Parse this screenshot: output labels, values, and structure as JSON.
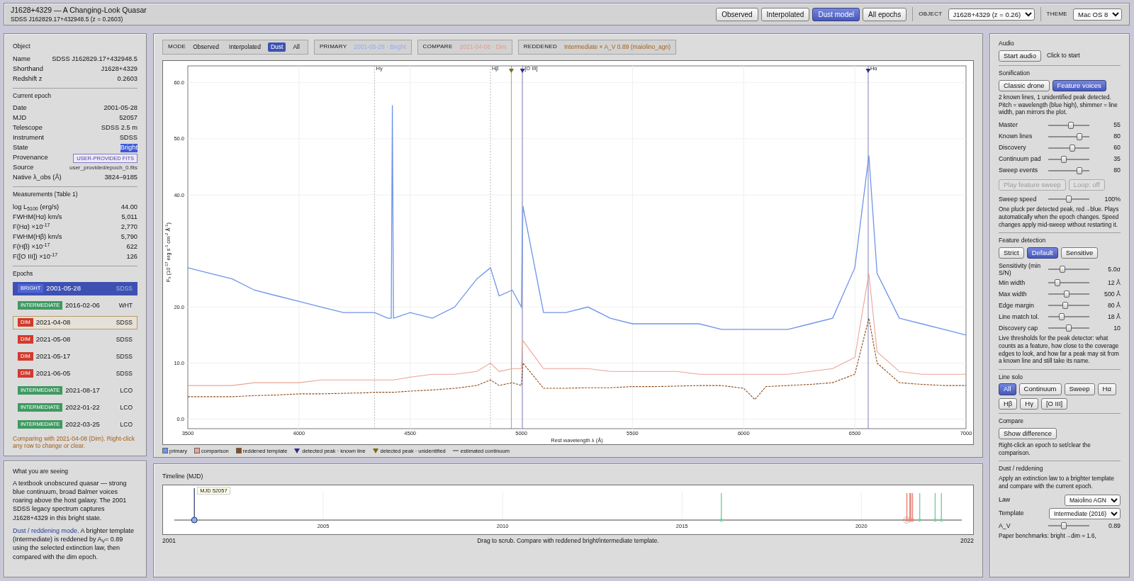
{
  "header": {
    "title": "J1628+4329 — A Changing-Look Quasar",
    "subtitle": "SDSS J162829.17+432948.5 (z = 0.2603)",
    "view_buttons": [
      {
        "label": "Observed",
        "selected": false
      },
      {
        "label": "Interpolated",
        "selected": false
      },
      {
        "label": "Dust model",
        "selected": true
      },
      {
        "label": "All epochs",
        "selected": false
      }
    ],
    "object_label": "OBJECT",
    "object_value": "J1628+4329 (z = 0.26)",
    "theme_label": "THEME",
    "theme_value": "Mac OS 8"
  },
  "object_panel": {
    "sections": [
      {
        "title": "Object",
        "rows": [
          {
            "label": "Name",
            "value": "SDSS J162829.17+432948.5"
          },
          {
            "label": "Shorthand",
            "value": "J1628+4329"
          },
          {
            "label": "Redshift z",
            "value": "0.2603"
          }
        ]
      },
      {
        "title": "Current epoch",
        "rows": [
          {
            "label": "Date",
            "value": "2001-05-28",
            "kind": "text",
            "highlighted": false
          },
          {
            "label": "MJD",
            "value": "52057",
            "kind": "text",
            "highlighted": false
          },
          {
            "label": "Telescope",
            "value": "SDSS 2.5 m",
            "kind": "text",
            "highlighted": false
          },
          {
            "label": "Instrument",
            "value": "SDSS",
            "kind": "text",
            "highlighted": false
          },
          {
            "label": "State",
            "value": "Bright",
            "kind": "text",
            "highlighted": true
          },
          {
            "label": "Provenance",
            "value": "USER-PROVIDED FITS",
            "kind": "badge",
            "highlighted": false
          },
          {
            "label": "Source",
            "value": "user_provided/epoch_0.fits",
            "kind": "path",
            "highlighted": false
          },
          {
            "label": "Native λ_obs (Å)",
            "value": "3824–9185",
            "kind": "text",
            "highlighted": false
          }
        ]
      },
      {
        "title": "Measurements (Table 1)",
        "rows": [
          {
            "label": "log L$_{5100}$ (erg/s)",
            "value": "44.00"
          },
          {
            "label": "FWHM(Hα) km/s",
            "value": "5,011"
          },
          {
            "label": "F(Hα) ×10$^{-17}$",
            "value": "2,770"
          },
          {
            "label": "FWHM(Hβ) km/s",
            "value": "5,790"
          },
          {
            "label": "F(Hβ) ×10$^{-17}$",
            "value": "622"
          },
          {
            "label": "F([O III]) ×10$^{-17}$",
            "value": "126"
          }
        ]
      }
    ],
    "epochs_title": "Epochs",
    "epochs": [
      {
        "state": "BRIGHT",
        "kind": "bright",
        "date": "2001-05-28",
        "telescope": "SDSS",
        "selected": true,
        "compare": false
      },
      {
        "state": "INTERMEDIATE",
        "kind": "intermediate",
        "date": "2016-02-06",
        "telescope": "WHT",
        "selected": false,
        "compare": false
      },
      {
        "state": "DIM",
        "kind": "dim",
        "date": "2021-04-08",
        "telescope": "SDSS",
        "selected": false,
        "compare": true
      },
      {
        "state": "DIM",
        "kind": "dim",
        "date": "2021-05-08",
        "telescope": "SDSS",
        "selected": false,
        "compare": false
      },
      {
        "state": "DIM",
        "kind": "dim",
        "date": "2021-05-17",
        "telescope": "SDSS",
        "selected": false,
        "compare": false
      },
      {
        "state": "DIM",
        "kind": "dim",
        "date": "2021-06-05",
        "telescope": "SDSS",
        "selected": false,
        "compare": false
      },
      {
        "state": "INTERMEDIATE",
        "kind": "intermediate",
        "date": "2021-08-17",
        "telescope": "LCO",
        "selected": false,
        "compare": false
      },
      {
        "state": "INTERMEDIATE",
        "kind": "intermediate",
        "date": "2022-01-22",
        "telescope": "LCO",
        "selected": false,
        "compare": false
      },
      {
        "state": "INTERMEDIATE",
        "kind": "intermediate",
        "date": "2022-03-25",
        "telescope": "LCO",
        "selected": false,
        "compare": false
      }
    ],
    "note": "Comparing with 2021-04-08 (Dim). Right-click any row to change or clear."
  },
  "explanation": {
    "title": "What you are seeing",
    "intro": "A textbook unobscured quasar — strong blue continuum, broad Balmer voices roaring above the host galaxy. The 2001 SDSS legacy spectrum captures J1628+4329 in this bright state.",
    "mode_link": "Dust / reddening mode",
    "mode_text": ". A brighter template (Intermediate) is reddened by A$_{V}$= 0.89 using the selected extinction law, then compared with the dim epoch."
  },
  "mode_bar": {
    "mode_label": "MODE",
    "modes": [
      {
        "label": "Observed",
        "selected": false
      },
      {
        "label": "Interpolated",
        "selected": false
      },
      {
        "label": "Dust",
        "selected": true
      },
      {
        "label": "All",
        "selected": false
      }
    ],
    "primary": {
      "label": "PRIMARY",
      "value": "2001-05-28 · Bright"
    },
    "compare": {
      "label": "COMPARE",
      "value": "2021-04-08 · Dim"
    },
    "reddened": {
      "label": "REDDENED",
      "value": "Intermediate × A_V 0.89 (maiolino_agn)"
    }
  },
  "spectrum": {
    "chart_data": {
      "type": "line",
      "xlabel": "Rest wavelength λ (Å)",
      "ylabel": "F$_{λ}$ (10$^{-17}$ erg s$^{-1}$ cm$^{-2}$ Å$^{-1}$)",
      "grid": true,
      "xlim": [
        3500,
        7000
      ],
      "ylim": [
        -1.7,
        63
      ],
      "xticks": [
        3500,
        4000,
        4500,
        5000,
        5500,
        6000,
        6500,
        7000
      ],
      "yticks": [
        {
          "value": 0,
          "label": "0.0"
        },
        {
          "value": 10,
          "label": "10.0"
        },
        {
          "value": 20,
          "label": "20.0"
        },
        {
          "value": 40,
          "label": "40.0"
        },
        {
          "value": 50,
          "label": "50.0"
        },
        {
          "value": 60,
          "label": "60.0"
        }
      ],
      "x": [
        3500,
        3600,
        3700,
        3800,
        3900,
        4000,
        4100,
        4200,
        4300,
        4340,
        4400,
        4415,
        4420,
        4425,
        4500,
        4600,
        4700,
        4800,
        4861,
        4900,
        4959,
        5000,
        5007,
        5100,
        5200,
        5300,
        5400,
        5500,
        5600,
        5700,
        5800,
        5900,
        6000,
        6050,
        6100,
        6200,
        6300,
        6400,
        6500,
        6563,
        6600,
        6700,
        6800,
        6900,
        7000
      ],
      "series": [
        {
          "name": "primary",
          "color": "#6f94ea",
          "line_style": "solid",
          "values": [
            27,
            26,
            25,
            23,
            22,
            21,
            20,
            19,
            19,
            19,
            18,
            18,
            56,
            18,
            19,
            18,
            20,
            25,
            27,
            22,
            23,
            20,
            38,
            19,
            19,
            20,
            18,
            17,
            17,
            17,
            17,
            16,
            16,
            16,
            16,
            16,
            17,
            18,
            27,
            47,
            26,
            18,
            17,
            16,
            15
          ]
        },
        {
          "name": "comparison",
          "color": "#eba396",
          "line_style": "solid",
          "values": [
            6,
            6,
            6,
            6.5,
            6.5,
            6.5,
            7,
            7,
            7,
            7,
            7,
            7,
            7,
            7,
            7.5,
            8,
            8,
            8.5,
            10,
            8.5,
            9,
            9,
            14,
            9,
            9,
            9,
            8.5,
            8.5,
            8.5,
            8.5,
            8,
            8,
            8,
            8,
            8,
            8,
            8.5,
            9,
            11,
            26,
            12,
            8.5,
            8,
            8,
            8
          ]
        },
        {
          "name": "reddened template",
          "color": "#8b4a1a",
          "line_style": "dashed",
          "values": [
            4,
            4,
            4,
            4.2,
            4.3,
            4.5,
            4.5,
            4.6,
            4.7,
            4.8,
            4.8,
            4.8,
            4.8,
            4.8,
            5,
            5.2,
            5.5,
            6,
            7,
            6,
            6.5,
            6,
            10,
            5.5,
            5.5,
            5.6,
            5.6,
            5.8,
            5.8,
            5.9,
            6,
            6,
            5.5,
            3.5,
            5.8,
            6,
            6.2,
            6.5,
            8,
            18,
            10,
            6.5,
            6.2,
            6,
            6
          ]
        }
      ],
      "ref_lines": [
        {
          "axis": "x",
          "value": 4340,
          "label": "Hγ"
        },
        {
          "axis": "x",
          "value": 4861,
          "label": "Hβ"
        },
        {
          "axis": "x",
          "value": 4955,
          "color": "#7a6a10"
        },
        {
          "axis": "x",
          "value": 5005,
          "label": "[O III]",
          "color": "#2c2c8c"
        },
        {
          "axis": "x",
          "value": 6560,
          "label": "Hα",
          "color": "#2c2c8c"
        }
      ]
    },
    "legend": [
      {
        "label": "detected peak · known line",
        "kind": "triangle",
        "color": "#2c2c8c"
      },
      {
        "label": "detected peak · unidentified",
        "kind": "triangle",
        "color": "#7a6a10"
      },
      {
        "label": "estimated continuum",
        "kind": "line",
        "color": "#888888"
      }
    ]
  },
  "timeline": {
    "title": "Timeline (MJD)",
    "marker_label": "MJD 52057",
    "ticks": [
      "2005",
      "2010",
      "2015",
      "2020"
    ],
    "start_label": "2001",
    "end_label": "2022",
    "caption": "Drag to scrub. Compare with reddened bright/intermediate template."
  },
  "controls": {
    "audio": {
      "title": "Audio",
      "button": "Start audio",
      "hint": "Click to start"
    },
    "sonification": {
      "title": "Sonification",
      "modes": [
        {
          "label": "Classic drone",
          "selected": false
        },
        {
          "label": "Feature voices",
          "selected": true
        }
      ],
      "description": "2 known lines, 1 unidentified peak detected. Pitch = wavelength (blue high), shimmer = line width, pan mirrors the plot.",
      "sliders": [
        {
          "label": "Master",
          "level": 0.55,
          "reading": "55"
        },
        {
          "label": "Known lines",
          "level": 0.8,
          "reading": "80"
        },
        {
          "label": "Discovery",
          "level": 0.6,
          "reading": "60"
        },
        {
          "label": "Continuum pad",
          "level": 0.35,
          "reading": "35"
        },
        {
          "label": "Sweep events",
          "level": 0.8,
          "reading": "80"
        }
      ],
      "actions": [
        {
          "label": "Play feature sweep",
          "disabled": true
        },
        {
          "label": "Loop: off",
          "disabled": true
        }
      ],
      "speed": {
        "label": "Sweep speed",
        "level": 0.5,
        "reading": "100%"
      },
      "note": "One pluck per detected peak, red→blue. Plays automatically when the epoch changes. Speed changes apply mid-sweep without restarting it."
    },
    "detection": {
      "title": "Feature detection",
      "presets": [
        {
          "label": "Strict",
          "selected": false
        },
        {
          "label": "Default",
          "selected": true
        },
        {
          "label": "Sensitive",
          "selected": false
        }
      ],
      "sliders": [
        {
          "label": "Sensitivity (min S/N)",
          "level": 0.32,
          "reading": "5.0σ"
        },
        {
          "label": "Min width",
          "level": 0.17,
          "reading": "12 Å"
        },
        {
          "label": "Max width",
          "level": 0.45,
          "reading": "500 Å"
        },
        {
          "label": "Edge margin",
          "level": 0.4,
          "reading": "80 Å"
        },
        {
          "label": "Line match tol.",
          "level": 0.3,
          "reading": "18 Å"
        },
        {
          "label": "Discovery cap",
          "level": 0.5,
          "reading": "10"
        }
      ],
      "note": "Live thresholds for the peak detector: what counts as a feature, how close to the coverage edges to look, and how far a peak may sit from a known line and still take its name."
    },
    "line_solo": {
      "title": "Line solo",
      "options": [
        {
          "label": "All",
          "selected": true
        },
        {
          "label": "Continuum",
          "selected": false
        },
        {
          "label": "Sweep",
          "selected": false
        },
        {
          "label": "Hα",
          "selected": false
        },
        {
          "label": "Hβ",
          "selected": false
        },
        {
          "label": "Hγ",
          "selected": false
        },
        {
          "label": "[O III]",
          "selected": false
        }
      ]
    },
    "compare": {
      "title": "Compare",
      "button": "Show difference",
      "note": "Right-click an epoch to set/clear the comparison."
    },
    "dust": {
      "title": "Dust / reddening",
      "note": "Apply an extinction law to a brighter template and compare with the current epoch.",
      "law_label": "Law",
      "law_value": "Maiolino AGN",
      "template_label": "Template",
      "template_value": "Intermediate (2016)",
      "av": {
        "label": "A_V",
        "level": 0.35,
        "reading": "0.89"
      },
      "benchmark": "Paper benchmarks: bright→dim ≈ 1.6,"
    }
  }
}
